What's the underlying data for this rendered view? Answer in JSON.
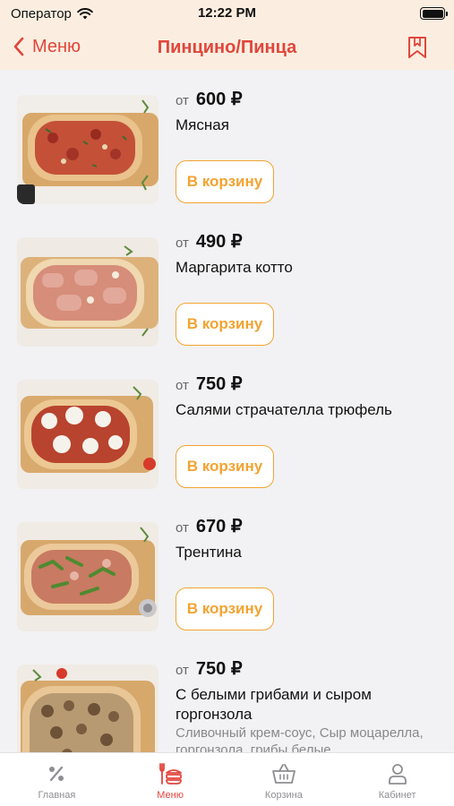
{
  "status": {
    "carrier": "Оператор",
    "time": "12:22 PM",
    "battery": 1.0
  },
  "nav": {
    "back_label": "Меню",
    "title": "Пинцино/Пинца"
  },
  "colors": {
    "accent": "#e0463c",
    "cart": "#f3a331",
    "header_bg": "#fbeee0"
  },
  "products": [
    {
      "price_prefix": "от",
      "price": "600 ₽",
      "name": "Мясная",
      "button": "В корзину"
    },
    {
      "price_prefix": "от",
      "price": "490 ₽",
      "name": "Маргарита котто",
      "button": "В корзину"
    },
    {
      "price_prefix": "от",
      "price": "750 ₽",
      "name": "Салями страчателла трюфель",
      "button": "В корзину"
    },
    {
      "price_prefix": "от",
      "price": "670 ₽",
      "name": "Трентина",
      "button": "В корзину"
    },
    {
      "price_prefix": "от",
      "price": "750 ₽",
      "name": "С белыми грибами и сыром горгонзола",
      "description": "Сливочный крем-соус, Сыр моцарелла, горгонзола, грибы белые"
    }
  ],
  "tabs": [
    {
      "label": "Главная",
      "icon": "discount-icon",
      "active": false
    },
    {
      "label": "Меню",
      "icon": "menu-food-icon",
      "active": true
    },
    {
      "label": "Корзина",
      "icon": "basket-icon",
      "active": false
    },
    {
      "label": "Кабинет",
      "icon": "profile-icon",
      "active": false
    }
  ]
}
